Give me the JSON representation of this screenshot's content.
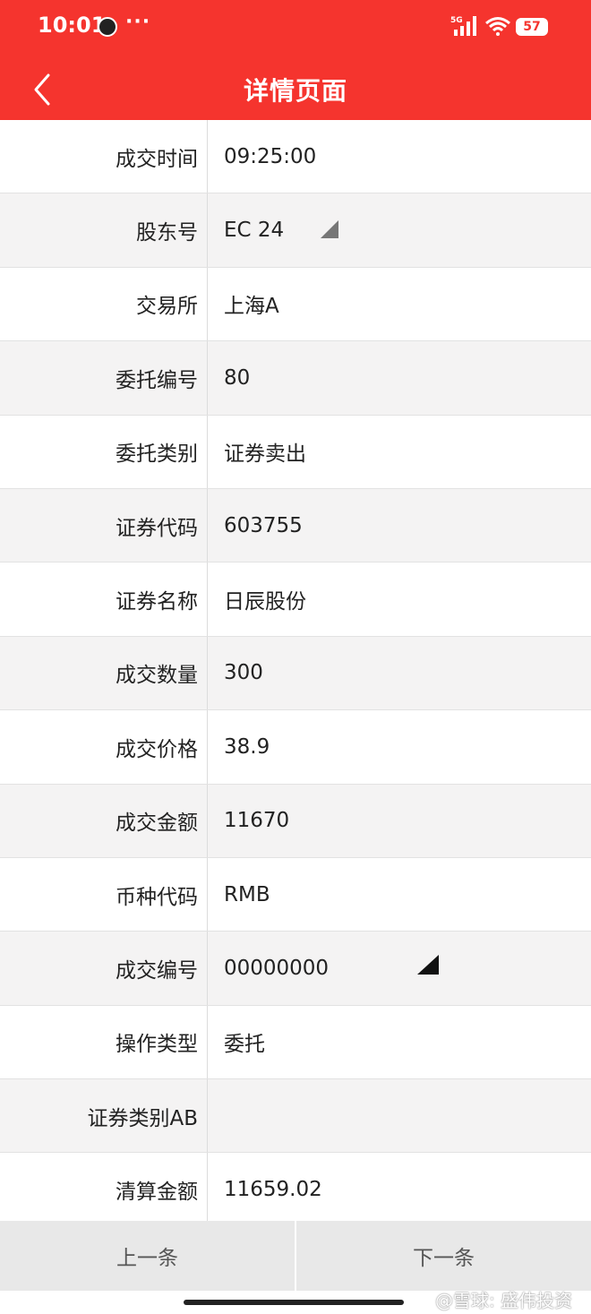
{
  "status_bar": {
    "time": "10:01",
    "dots": "···",
    "network": "5G",
    "battery": "57"
  },
  "header": {
    "title": "详情页面"
  },
  "rows": [
    {
      "label": "成交时间",
      "value": "09:25:00"
    },
    {
      "label": "股东号",
      "value": "EC     24"
    },
    {
      "label": "交易所",
      "value": "上海A"
    },
    {
      "label": "委托编号",
      "value": "80"
    },
    {
      "label": "委托类别",
      "value": "证券卖出"
    },
    {
      "label": "证券代码",
      "value": "603755"
    },
    {
      "label": "证券名称",
      "value": "日辰股份"
    },
    {
      "label": "成交数量",
      "value": "300"
    },
    {
      "label": "成交价格",
      "value": "38.9"
    },
    {
      "label": "成交金额",
      "value": "11670"
    },
    {
      "label": "币种代码",
      "value": "RMB"
    },
    {
      "label": "成交编号",
      "value": "00000000"
    },
    {
      "label": "操作类型",
      "value": "委托"
    },
    {
      "label": "证券类别AB",
      "value": ""
    },
    {
      "label": "清算金额",
      "value": "11659.02"
    }
  ],
  "footer": {
    "prev_label": "上一条",
    "next_label": "下一条"
  },
  "watermark": "@雪球: 盛伟投资",
  "colors": {
    "header_bg": "#f5342e",
    "alt_row_bg": "#f4f3f3",
    "footer_bg": "#e8e8e8"
  }
}
